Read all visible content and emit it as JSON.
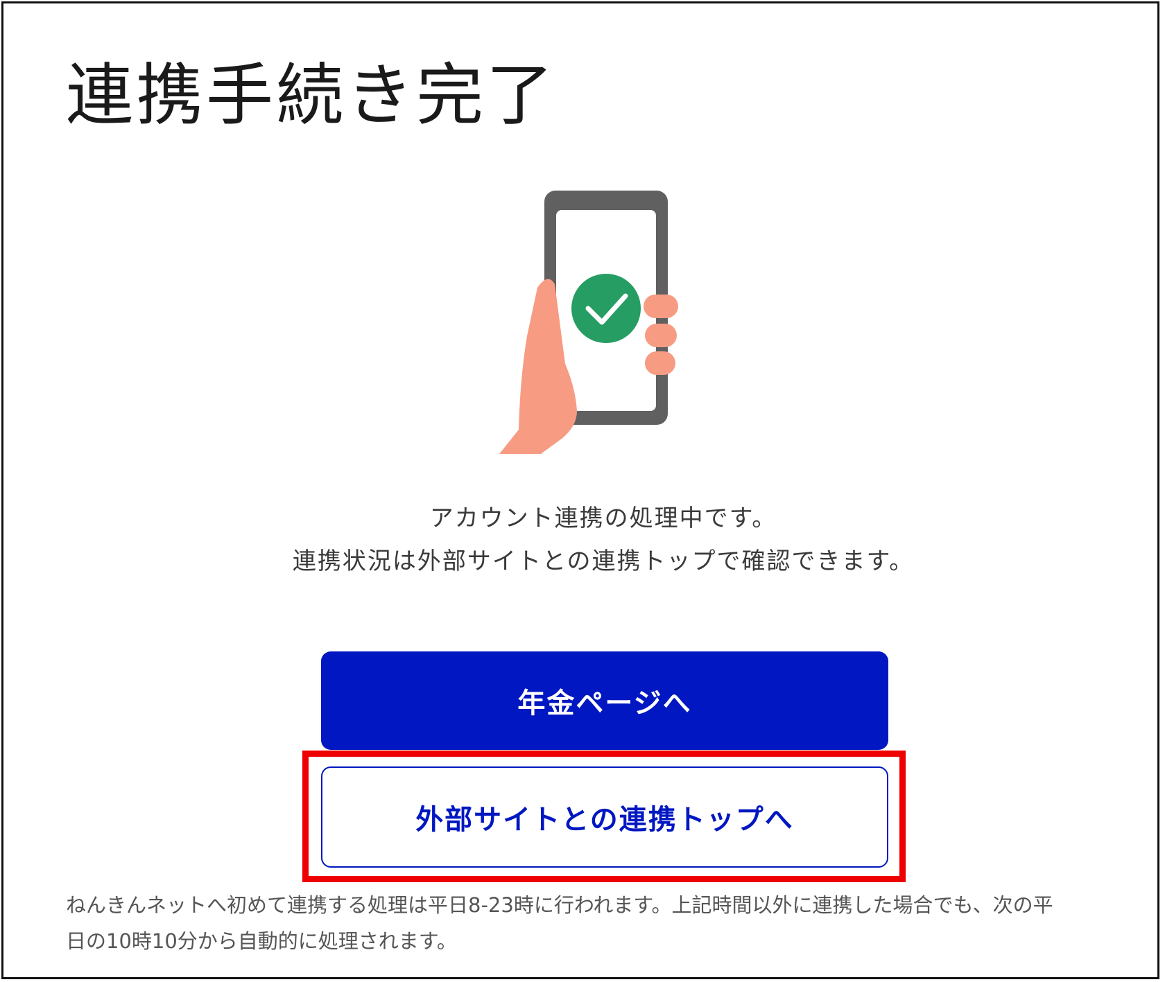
{
  "page": {
    "title": "連携手続き完了"
  },
  "status": {
    "line1": "アカウント連携の処理中です。",
    "line2": "連携状況は外部サイトとの連携トップで確認できます。"
  },
  "buttons": {
    "pension_label": "年金ページへ",
    "external_top_label": "外部サイトとの連携トップへ"
  },
  "note": {
    "line1": "ねんきんネットへ初めて連携する処理は平日8-23時に行われます。上記時間以外に連携した場合でも、次の平",
    "line2": "日の10時10分から自動的に処理されます。"
  },
  "colors": {
    "primary": "#0017c1",
    "success": "#259d63",
    "skin": "#f79b83",
    "phone": "#606060",
    "highlight": "#ee0000"
  },
  "icons": {
    "illustration": "phone-in-hand-with-checkmark"
  }
}
